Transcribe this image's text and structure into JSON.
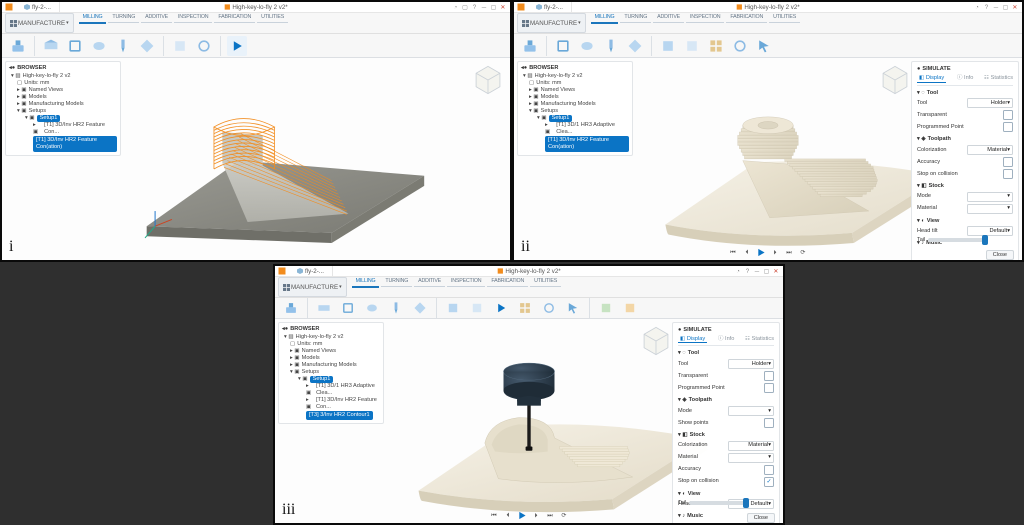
{
  "app": {
    "manufacture_label": "MANUFACTURE"
  },
  "file": {
    "name": "High-key-lo-fly 2 v2*",
    "short": "fly-2-..."
  },
  "workspaces": [
    "MILLING",
    "TURNING",
    "ADDITIVE",
    "INSPECTION",
    "FABRICATION",
    "UTILITIES"
  ],
  "workspace_active": 0,
  "browser": {
    "header": "BROWSER",
    "root": "High-key-lo-fly 2 v2",
    "units": "Units: mm",
    "named_views": "Named Views",
    "models": "Models",
    "mfg_models": "Manufacturing Models",
    "setups": "Setups",
    "setup1": "Setup1",
    "op_adaptive": "[T1] 3D/1 HR3 Adaptive Clea...",
    "op_feature": "[T1] 3D/Inv HR2 Feature Con...",
    "op_selected_p1": "[T1] 3D/Inv HR2 Feature Con(ation)",
    "op_selected_p2": "[T3] 3/Inv HR2 Contour1"
  },
  "sim_panel": {
    "title": "SIMULATE",
    "display": "Display",
    "info": "Info",
    "statistics": "Statistics",
    "tool_section": "Tool",
    "tool": "Tool",
    "holder": "Holder",
    "transparent": "Transparent",
    "programmed_point": "Programmed Point",
    "toolpath_section": "Toolpath",
    "colorization": "Colorization",
    "show_points": "Show points",
    "mode": "Mode",
    "toolpath": "Toolpath",
    "accuracy": "Accuracy",
    "all_ops": "Tail",
    "stock_section": "Stock",
    "material": "Material",
    "colorization2": "Colorization",
    "stop_on_collision": "Stop on collision",
    "view_section": "View",
    "head_tilt": "Head tilt",
    "music_section": "Music",
    "close": "Close",
    "val_holder": "Holder",
    "val_material": "Material",
    "val_head": "Default"
  },
  "labels": {
    "panel_i": "i",
    "panel_ii": "ii",
    "panel_iii": "iii"
  }
}
